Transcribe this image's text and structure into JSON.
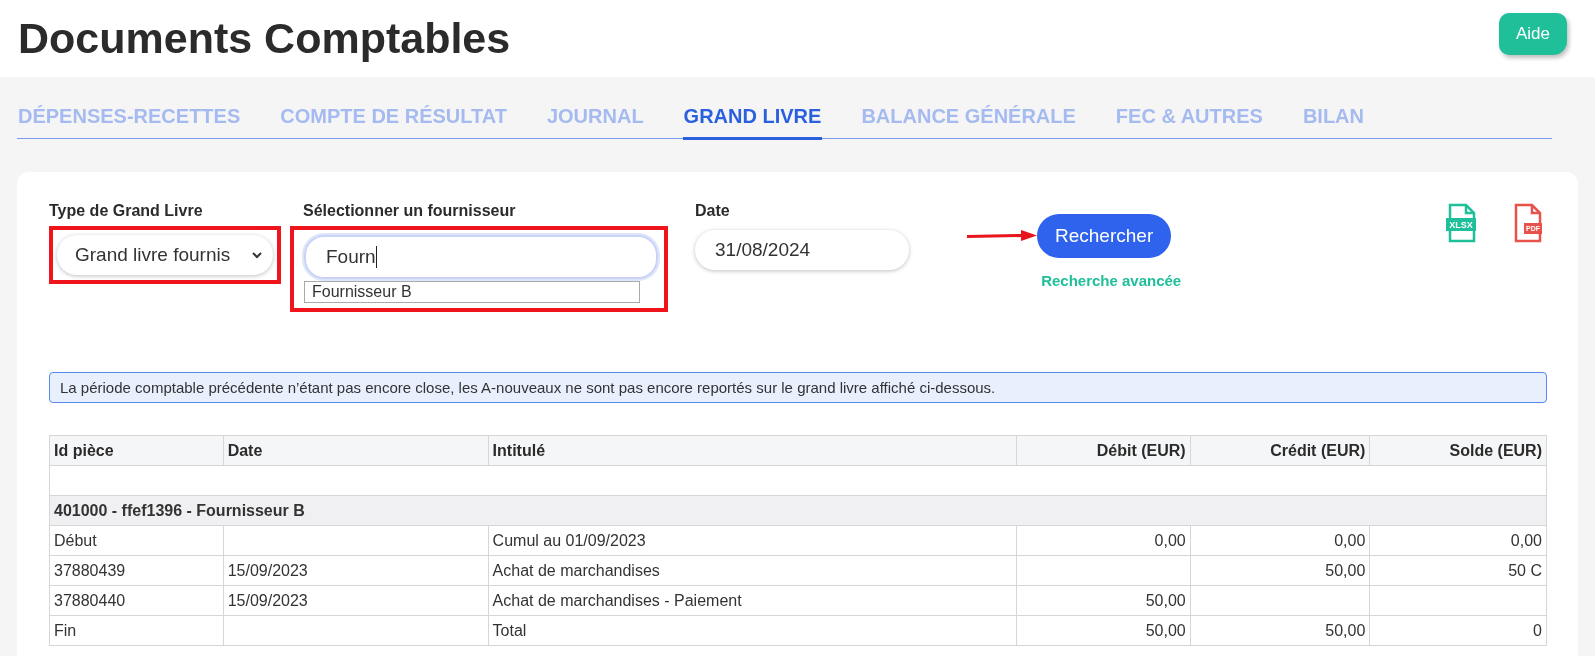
{
  "page": {
    "title": "Documents Comptables",
    "help_button": "Aide"
  },
  "tabs": [
    {
      "label": "DÉPENSES-RECETTES",
      "selected": false
    },
    {
      "label": "COMPTE DE RÉSULTAT",
      "selected": false
    },
    {
      "label": "JOURNAL",
      "selected": false
    },
    {
      "label": "GRAND LIVRE",
      "selected": true
    },
    {
      "label": "BALANCE GÉNÉRALE",
      "selected": false
    },
    {
      "label": "FEC & AUTRES",
      "selected": false
    },
    {
      "label": "BILAN",
      "selected": false
    }
  ],
  "filters": {
    "ledger_type": {
      "label": "Type de Grand Livre",
      "value": "Grand livre fournis"
    },
    "supplier": {
      "label": "Sélectionner un fournisseur",
      "value": "Fourn",
      "suggestion": "Fournisseur B"
    },
    "date": {
      "label": "Date",
      "value": "31/08/2024"
    },
    "search_button": "Rechercher",
    "advanced_search_link": "Recherche avancée",
    "export_icons": [
      {
        "kind": "xlsx",
        "label": "XLSX"
      },
      {
        "kind": "pdf",
        "label": "PDF"
      }
    ]
  },
  "notice": "La période comptable précédente n’étant pas encore close, les A-nouveaux ne sont pas encore reportés sur le grand livre affiché ci-dessous.",
  "table": {
    "columns": [
      "Id pièce",
      "Date",
      "Intitulé",
      "Débit (EUR)",
      "Crédit (EUR)",
      "Solde (EUR)"
    ],
    "rows": [
      {
        "kind": "spacer"
      },
      {
        "kind": "group",
        "label": "401000 - ffef1396 - Fournisseur B"
      },
      {
        "kind": "data",
        "cells": [
          "Début",
          "",
          "Cumul au 01/09/2023",
          "0,00",
          "0,00",
          "0,00"
        ]
      },
      {
        "kind": "data",
        "cells": [
          "37880439",
          "15/09/2023",
          "Achat de marchandises",
          "",
          "50,00",
          "50 C"
        ]
      },
      {
        "kind": "data",
        "cells": [
          "37880440",
          "15/09/2023",
          "Achat de marchandises - Paiement",
          "50,00",
          "",
          ""
        ]
      },
      {
        "kind": "data",
        "cells": [
          "Fin",
          "",
          "Total",
          "50,00",
          "50,00",
          "0"
        ]
      }
    ]
  }
}
